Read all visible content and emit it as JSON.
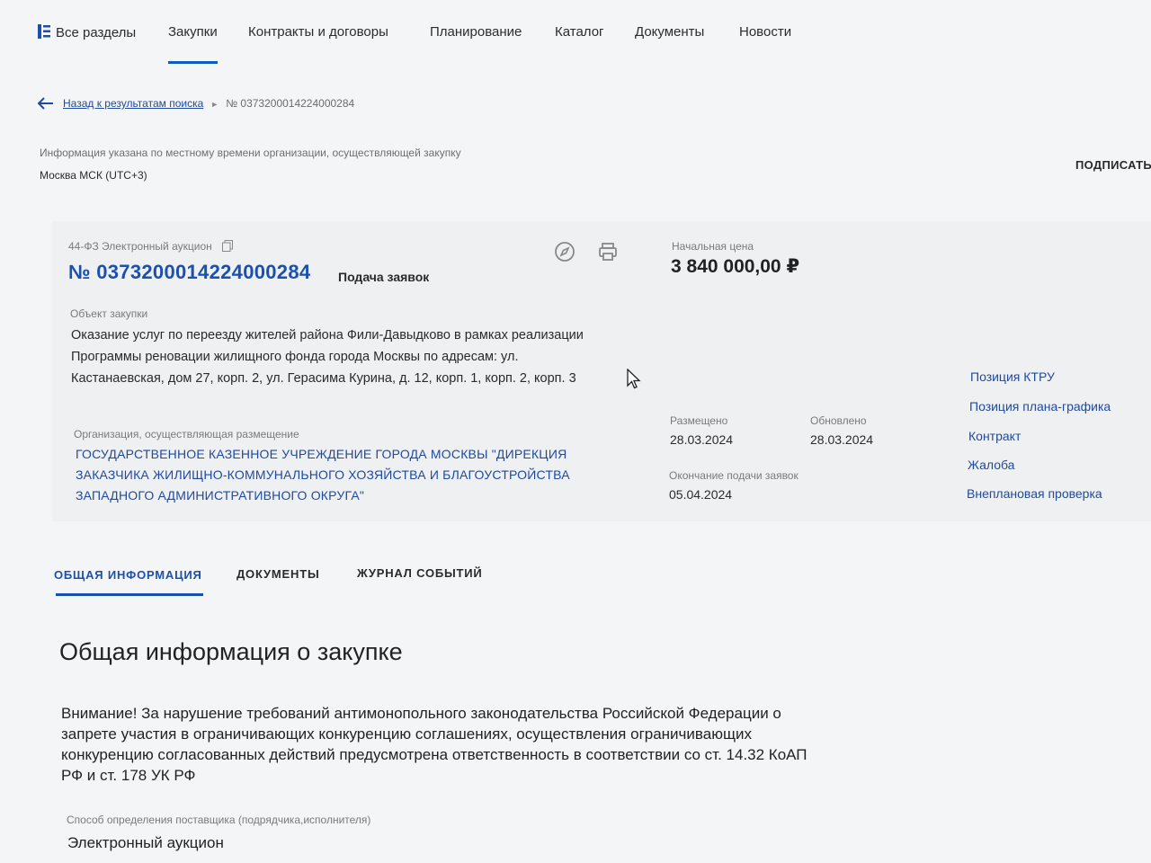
{
  "nav": {
    "all_sections": "Все разделы",
    "items": [
      "Закупки",
      "Контракты и договоры",
      "Планирование",
      "Каталог",
      "Документы",
      "Новости"
    ],
    "active": "Закупки"
  },
  "breadcrumb": {
    "back": "Назад к результатам поиска",
    "current": "№ 0373200014224000284"
  },
  "timezone": {
    "note": "Информация указана по местному времени организации, осуществляющей закупку",
    "value": "Москва МСК (UTC+3)"
  },
  "sign_button": "ПОДПИСАТЬ",
  "procurement": {
    "law": "44-ФЗ Электронный аукцион",
    "number": "№ 0373200014224000284",
    "stage": "Подача заявок",
    "price_label": "Начальная цена",
    "price": "3 840 000,00 ₽",
    "object_label": "Объект закупки",
    "object": "Оказание услуг по переезду жителей района Фили-Давыдково в рамках реализации Программы реновации жилищного фонда города Москвы по адресам: ул. Кастанаевская, дом 27, корп. 2, ул. Герасима Курина, д. 12, корп. 1, корп. 2, корп. 3",
    "org_label": "Организация, осуществляющая размещение",
    "org": "ГОСУДАРСТВЕННОЕ КАЗЕННОЕ УЧРЕЖДЕНИЕ ГОРОДА МОСКВЫ \"ДИРЕКЦИЯ ЗАКАЗЧИКА ЖИЛИЩНО-КОММУНАЛЬНОГО ХОЗЯЙСТВА И БЛАГОУСТРОЙСТВА ЗАПАДНОГО АДМИНИСТРАТИВНОГО ОКРУГА\"",
    "posted_label": "Размещено",
    "posted": "28.03.2024",
    "updated_label": "Обновлено",
    "updated": "28.03.2024",
    "deadline_label": "Окончание подачи заявок",
    "deadline": "05.04.2024"
  },
  "side_links": [
    "Позиция КТРУ",
    "Позиция плана-графика",
    "Контракт",
    "Жалоба",
    "Внеплановая проверка"
  ],
  "tabs": [
    "ОБЩАЯ ИНФОРМАЦИЯ",
    "ДОКУМЕНТЫ",
    "ЖУРНАЛ СОБЫТИЙ"
  ],
  "section": {
    "title": "Общая информация о закупке",
    "warning": "Внимание! За нарушение требований антимонопольного законодательства Российской Федерации о запрете участия в ограничивающих конкуренцию соглашениях, осуществления ограничивающих конкуренцию согласованных действий предусмотрена ответственность в соответствии со ст. 14.32 КоАП РФ и ст. 178 УК РФ",
    "method_label": "Способ определения поставщика (подрядчика,исполнителя)",
    "method_value": "Электронный аукцион"
  },
  "colors": {
    "link": "#1f4aa0",
    "accent": "#1b4fb0",
    "card_bg": "#eef0f2"
  },
  "icons": [
    "all-sections-icon",
    "back-arrow-icon",
    "copy-icon",
    "compass-icon",
    "print-icon",
    "mouse-cursor-icon"
  ]
}
